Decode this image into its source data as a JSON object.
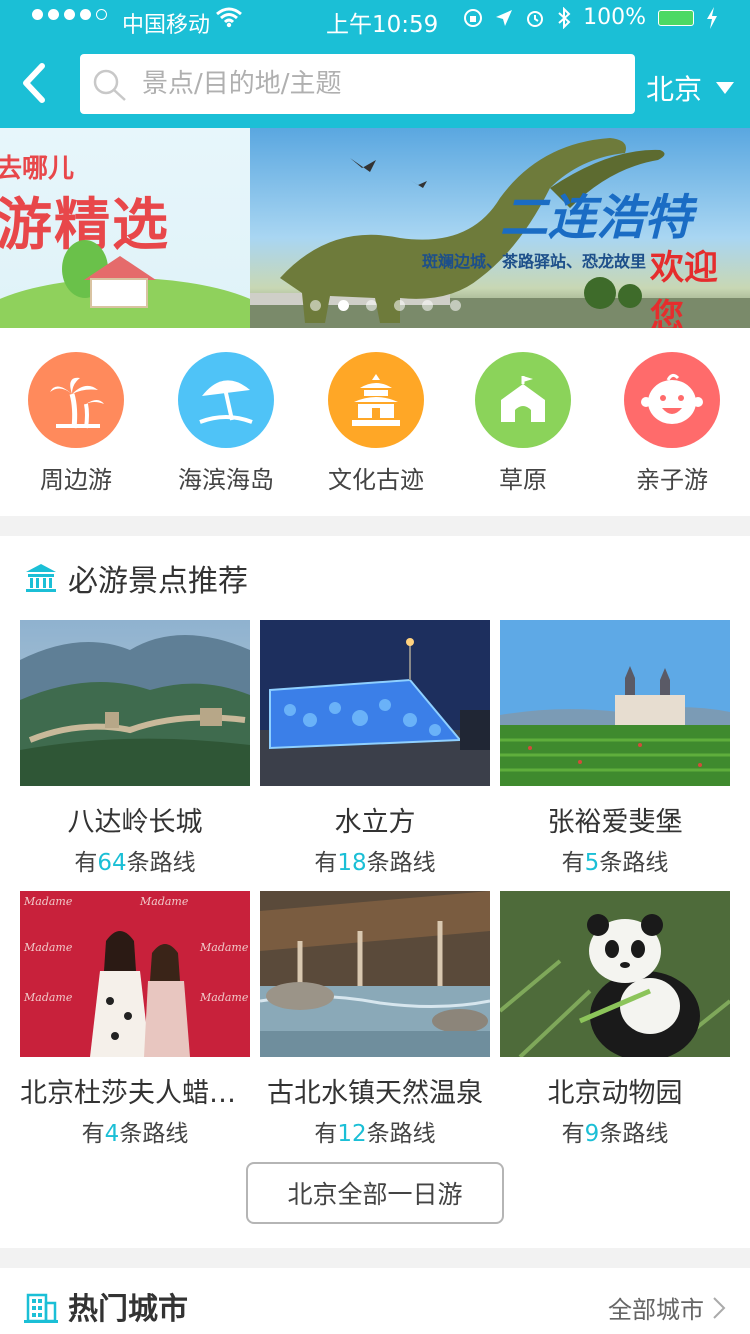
{
  "status_bar": {
    "carrier": "中国移动",
    "time": "上午10:59",
    "battery": "100%"
  },
  "nav": {
    "search_placeholder": "景点/目的地/主题",
    "city": "北京"
  },
  "banner": {
    "left_slide_line1": "去哪儿",
    "left_slide_line2": "游精选",
    "main_slide_title": "二连浩特",
    "main_slide_subtitle": "斑斓边城、茶路驿站、恐龙故里",
    "main_slide_welcome": "欢迎您",
    "slide_count": 6,
    "active_slide": 2
  },
  "categories": [
    {
      "label": "周边游",
      "icon": "palm-tree-icon",
      "color": "#ff8a5c"
    },
    {
      "label": "海滨海岛",
      "icon": "beach-umbrella-icon",
      "color": "#4fc3f7"
    },
    {
      "label": "文化古迹",
      "icon": "temple-icon",
      "color": "#ffa726"
    },
    {
      "label": "草原",
      "icon": "yurt-icon",
      "color": "#8bd35a"
    },
    {
      "label": "亲子游",
      "icon": "baby-face-icon",
      "color": "#ff6b6b"
    }
  ],
  "must_visit": {
    "title": "必游景点推荐",
    "items": [
      {
        "name": "八达岭长城",
        "prefix": "有",
        "count": "64",
        "suffix": "条路线"
      },
      {
        "name": "水立方",
        "prefix": "有",
        "count": "18",
        "suffix": "条路线"
      },
      {
        "name": "张裕爱斐堡",
        "prefix": "有",
        "count": "5",
        "suffix": "条路线"
      },
      {
        "name": "北京杜莎夫人蜡像馆",
        "prefix": "有",
        "count": "4",
        "suffix": "条路线"
      },
      {
        "name": "古北水镇天然温泉",
        "prefix": "有",
        "count": "12",
        "suffix": "条路线"
      },
      {
        "name": "北京动物园",
        "prefix": "有",
        "count": "9",
        "suffix": "条路线"
      }
    ],
    "all_button": "北京全部一日游"
  },
  "hot_cities": {
    "title": "热门城市",
    "more": "全部城市"
  },
  "colors": {
    "accent": "#1bbfd6",
    "count_highlight": "#1bbfd6"
  }
}
